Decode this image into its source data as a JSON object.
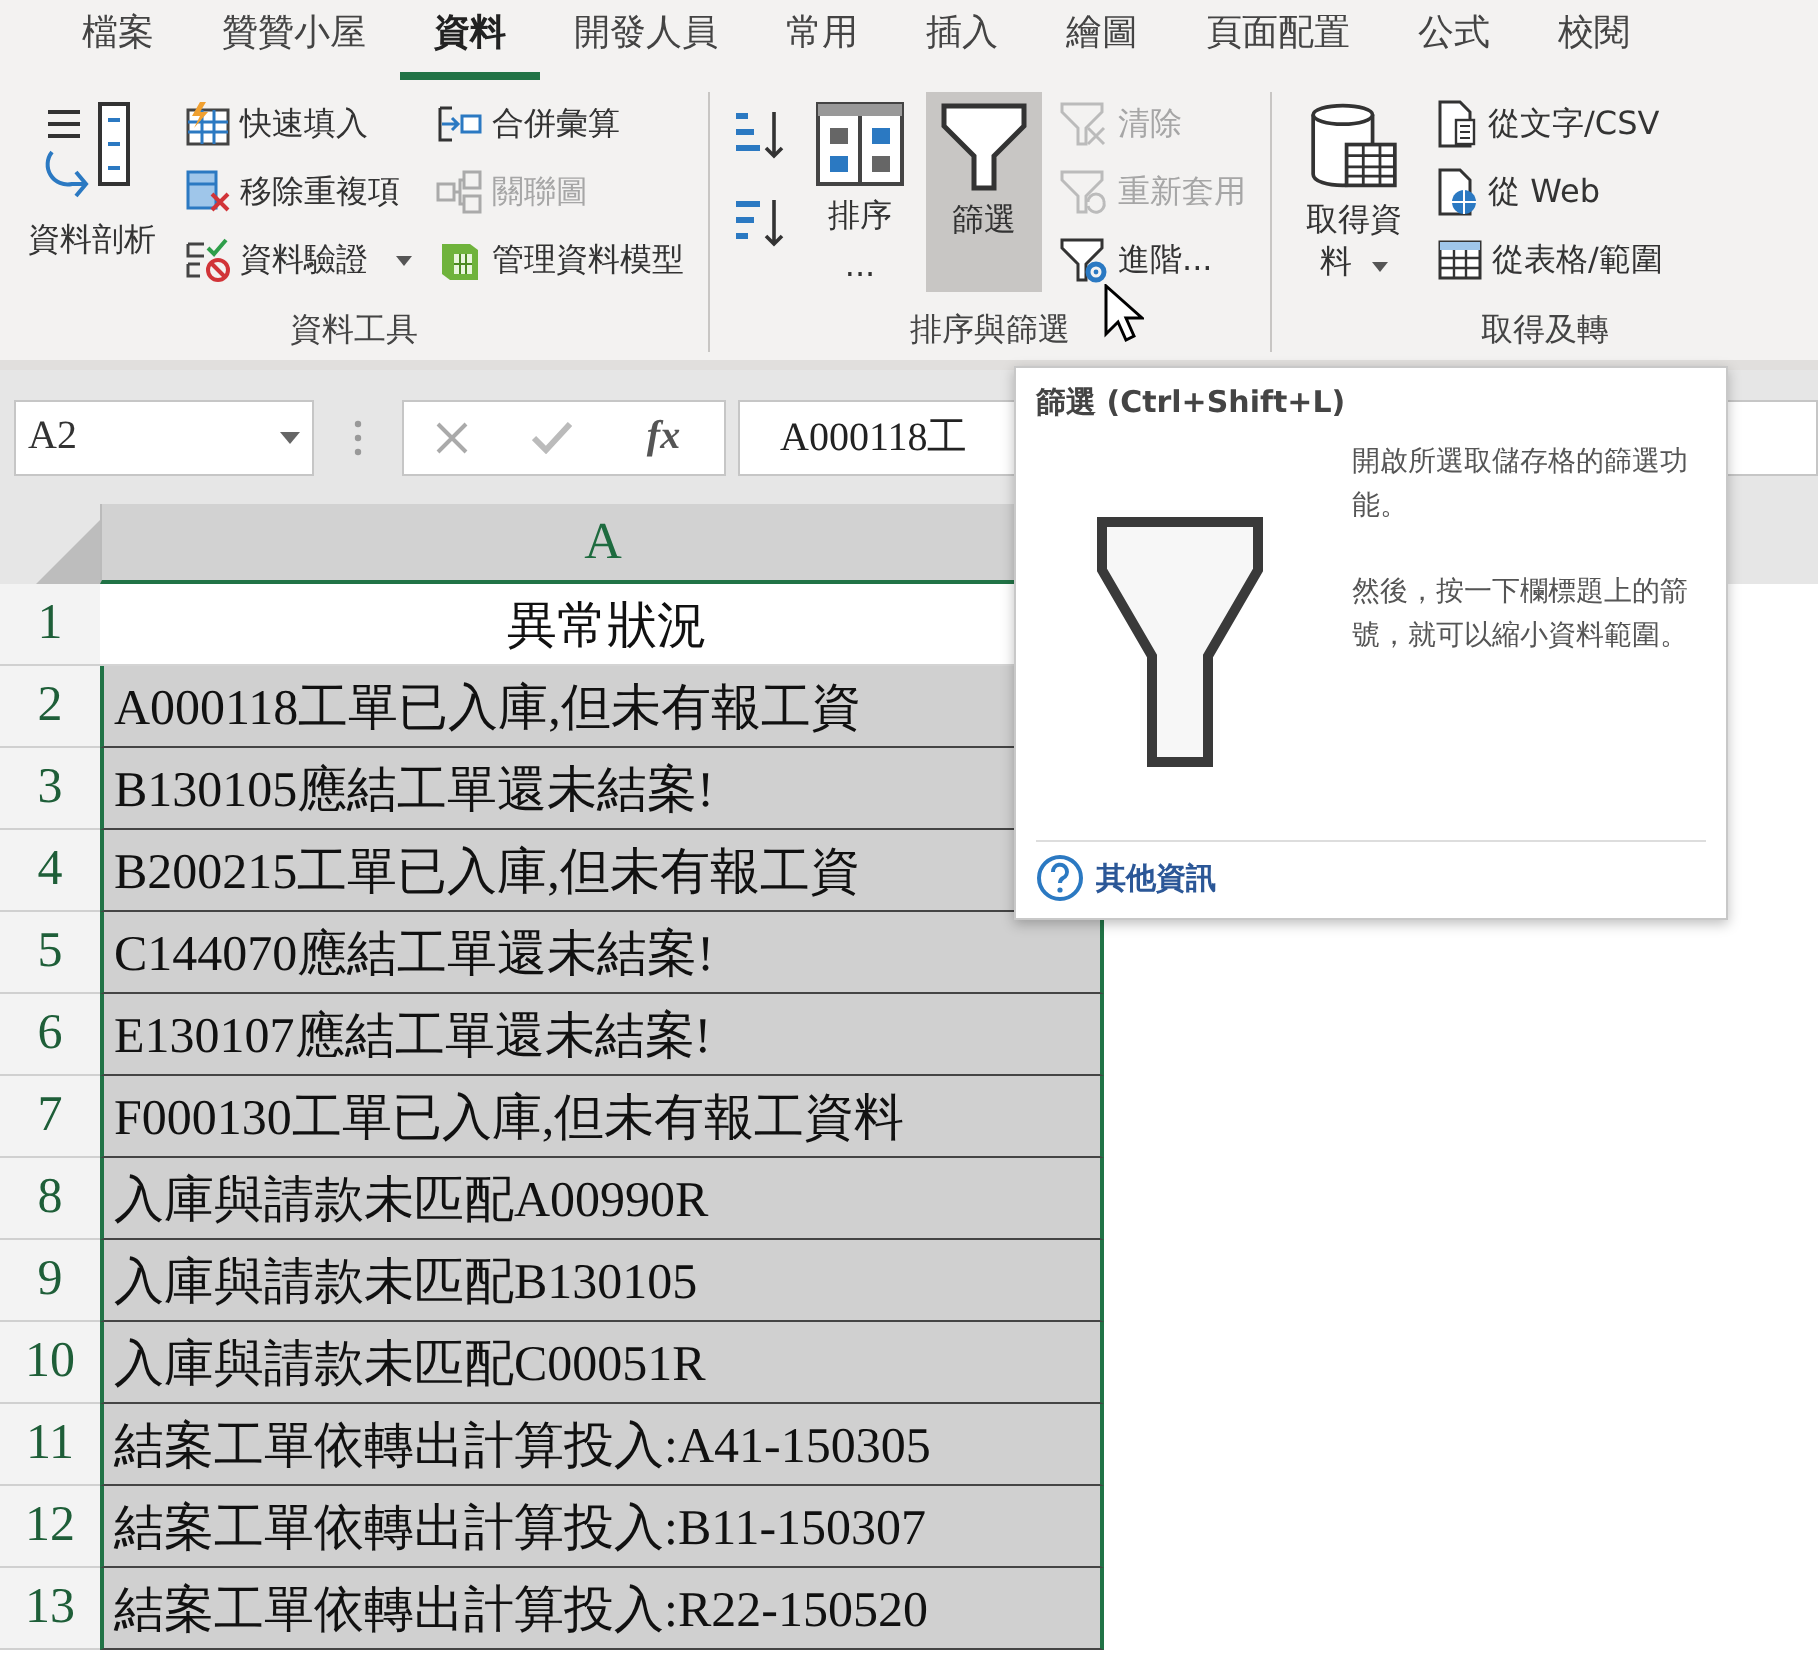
{
  "tabs": [
    {
      "label": "檔案",
      "selected": false
    },
    {
      "label": "贊贊小屋",
      "selected": false
    },
    {
      "label": "資料",
      "selected": true
    },
    {
      "label": "開發人員",
      "selected": false
    },
    {
      "label": "常用",
      "selected": false
    },
    {
      "label": "插入",
      "selected": false
    },
    {
      "label": "繪圖",
      "selected": false
    },
    {
      "label": "頁面配置",
      "selected": false
    },
    {
      "label": "公式",
      "selected": false
    },
    {
      "label": "校閱",
      "selected": false
    }
  ],
  "ribbon": [
    {
      "label": "資料工具",
      "columns": [
        [
          {
            "kind": "large",
            "label": "資料剖析"
          }
        ],
        [
          {
            "kind": "small",
            "label": "快速填入",
            "disabled": false
          },
          {
            "kind": "small",
            "label": "移除重複項",
            "disabled": false
          },
          {
            "kind": "dropdown",
            "label": "資料驗證",
            "disabled": false
          }
        ],
        [
          {
            "kind": "small",
            "label": "合併彙算",
            "disabled": false
          },
          {
            "kind": "small",
            "label": "關聯圖",
            "disabled": true
          },
          {
            "kind": "small",
            "label": "管理資料模型",
            "disabled": false
          }
        ]
      ]
    },
    {
      "label": "排序與篩選",
      "columns": [
        [
          {
            "kind": "icon"
          },
          {
            "kind": "icon"
          }
        ],
        [
          {
            "kind": "large",
            "label": "排序",
            "sublabel": "..."
          }
        ],
        [
          {
            "kind": "large",
            "label": "篩選",
            "highlighted": true
          }
        ],
        [
          {
            "kind": "small",
            "label": "清除",
            "disabled": true
          },
          {
            "kind": "small",
            "label": "重新套用",
            "disabled": true
          },
          {
            "kind": "small",
            "label": "進階...",
            "disabled": false
          }
        ]
      ]
    },
    {
      "label": "取得及轉",
      "columns": [
        [
          {
            "kind": "large",
            "label": "取得資料",
            "dropdown": true
          }
        ],
        [
          {
            "kind": "small",
            "label": "從文字/CSV",
            "disabled": false
          },
          {
            "kind": "small",
            "label": "從 Web",
            "disabled": false
          },
          {
            "kind": "small",
            "label": "從表格/範圍",
            "disabled": false
          }
        ]
      ]
    }
  ],
  "name_box": "A2",
  "formula_buttons": {
    "function_label": "fx"
  },
  "formula": "A000118工",
  "column_header": "A",
  "rows": [
    {
      "number": "1",
      "text": "異常狀況",
      "selected": false
    },
    {
      "number": "2",
      "text": "A000118工單已入庫,但未有報工資",
      "selected": true
    },
    {
      "number": "3",
      "text": "B130105應結工單還未結案!",
      "selected": true
    },
    {
      "number": "4",
      "text": "B200215工單已入庫,但未有報工資",
      "selected": true
    },
    {
      "number": "5",
      "text": "C144070應結工單還未結案!",
      "selected": true
    },
    {
      "number": "6",
      "text": "E130107應結工單還未結案!",
      "selected": true
    },
    {
      "number": "7",
      "text": "F000130工單已入庫,但未有報工資料",
      "selected": true
    },
    {
      "number": "8",
      "text": "入庫與請款未匹配A00990R",
      "selected": true
    },
    {
      "number": "9",
      "text": "入庫與請款未匹配B130105",
      "selected": true
    },
    {
      "number": "10",
      "text": "入庫與請款未匹配C00051R",
      "selected": true
    },
    {
      "number": "11",
      "text": "結案工單依轉出計算投入:A41-150305",
      "selected": true
    },
    {
      "number": "12",
      "text": "結案工單依轉出計算投入:B11-150307",
      "selected": true
    },
    {
      "number": "13",
      "text": "結案工單依轉出計算投入:R22-150520",
      "selected": true
    }
  ],
  "tooltip": {
    "title": "篩選 (Ctrl+Shift+L)",
    "paragraphs": [
      "開啟所選取儲存格的篩選功能。",
      "然後，按一下欄標題上的箭號，就可以縮小資料範圍。"
    ],
    "link": "其他資訊"
  }
}
